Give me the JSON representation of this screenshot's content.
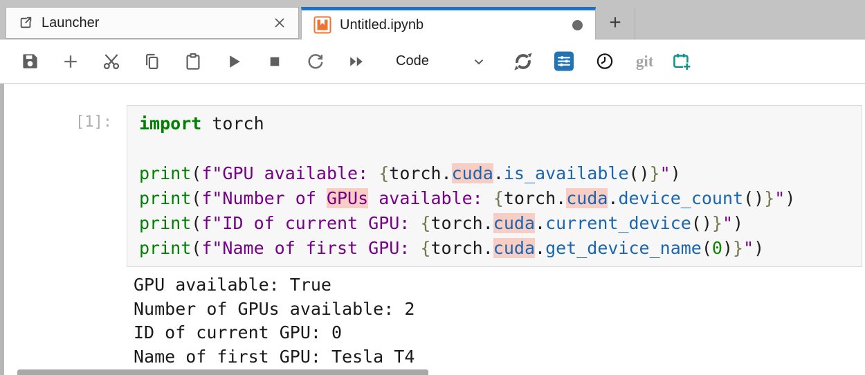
{
  "tab_bar": {
    "tabs": [
      {
        "label": "Launcher",
        "icon": "launcher-icon",
        "active": false,
        "has_close": true
      },
      {
        "label": "Untitled.ipynb",
        "icon": "notebook-icon",
        "active": true,
        "dirty": true
      }
    ],
    "add_tab_label": "+"
  },
  "toolbar": {
    "buttons": [
      "save",
      "insert-cell-below",
      "cut-cells",
      "copy-cells",
      "paste-cells",
      "run-cell",
      "interrupt-kernel",
      "restart-kernel",
      "restart-and-run-all"
    ],
    "cell_type_dropdown": {
      "value": "Code"
    },
    "right_buttons": [
      "kernel-swirl",
      "cell-tools-sliders",
      "history-clock",
      "git",
      "create-scheduled-job"
    ],
    "git_label": "git"
  },
  "cell": {
    "prompt": "[1]:",
    "code_lines": [
      [
        {
          "t": "import",
          "c": "kw"
        },
        {
          "t": " torch",
          "c": "pl"
        }
      ],
      [],
      [
        {
          "t": "print",
          "c": "bi"
        },
        {
          "t": "(",
          "c": "pl"
        },
        {
          "t": "f\"GPU available: ",
          "c": "st"
        },
        {
          "t": "{",
          "c": "br"
        },
        {
          "t": "torch",
          "c": "pl"
        },
        {
          "t": ".",
          "c": "pl"
        },
        {
          "t": "cuda",
          "c": "pr",
          "h": true
        },
        {
          "t": ".",
          "c": "pl"
        },
        {
          "t": "is_available",
          "c": "pr"
        },
        {
          "t": "()",
          "c": "pl"
        },
        {
          "t": "}",
          "c": "br"
        },
        {
          "t": "\"",
          "c": "st"
        },
        {
          "t": ")",
          "c": "pl"
        }
      ],
      [
        {
          "t": "print",
          "c": "bi"
        },
        {
          "t": "(",
          "c": "pl"
        },
        {
          "t": "f\"Number of ",
          "c": "st"
        },
        {
          "t": "GPUs",
          "c": "st",
          "h": true
        },
        {
          "t": " available: ",
          "c": "st"
        },
        {
          "t": "{",
          "c": "br"
        },
        {
          "t": "torch",
          "c": "pl"
        },
        {
          "t": ".",
          "c": "pl"
        },
        {
          "t": "cuda",
          "c": "pr",
          "h": true
        },
        {
          "t": ".",
          "c": "pl"
        },
        {
          "t": "device_count",
          "c": "pr"
        },
        {
          "t": "()",
          "c": "pl"
        },
        {
          "t": "}",
          "c": "br"
        },
        {
          "t": "\"",
          "c": "st"
        },
        {
          "t": ")",
          "c": "pl"
        }
      ],
      [
        {
          "t": "print",
          "c": "bi"
        },
        {
          "t": "(",
          "c": "pl"
        },
        {
          "t": "f\"ID of current GPU: ",
          "c": "st"
        },
        {
          "t": "{",
          "c": "br"
        },
        {
          "t": "torch",
          "c": "pl"
        },
        {
          "t": ".",
          "c": "pl"
        },
        {
          "t": "cuda",
          "c": "pr",
          "h": true
        },
        {
          "t": ".",
          "c": "pl"
        },
        {
          "t": "current_device",
          "c": "pr"
        },
        {
          "t": "()",
          "c": "pl"
        },
        {
          "t": "}",
          "c": "br"
        },
        {
          "t": "\"",
          "c": "st"
        },
        {
          "t": ")",
          "c": "pl"
        }
      ],
      [
        {
          "t": "print",
          "c": "bi"
        },
        {
          "t": "(",
          "c": "pl"
        },
        {
          "t": "f\"Name of first GPU: ",
          "c": "st"
        },
        {
          "t": "{",
          "c": "br"
        },
        {
          "t": "torch",
          "c": "pl"
        },
        {
          "t": ".",
          "c": "pl"
        },
        {
          "t": "cuda",
          "c": "pr",
          "h": true
        },
        {
          "t": ".",
          "c": "pl"
        },
        {
          "t": "get_device_name",
          "c": "pr"
        },
        {
          "t": "(",
          "c": "pl"
        },
        {
          "t": "0",
          "c": "nu"
        },
        {
          "t": ")",
          "c": "pl"
        },
        {
          "t": "}",
          "c": "br"
        },
        {
          "t": "\"",
          "c": "st"
        },
        {
          "t": ")",
          "c": "pl"
        }
      ]
    ],
    "outputs": [
      "GPU available: True",
      "Number of GPUs available: 2",
      "ID of current GPU: 0",
      "Name of first GPU: Tesla T4"
    ]
  },
  "colors": {
    "active_tab_accent": "#1a73c8",
    "notebook_icon_orange": "#ee7531",
    "sliders_button_blue": "#2374b5",
    "scheduler_teal": "#12948b",
    "match_highlight_pink": "#f7cdc4",
    "tabbar_gray": "#c3c3c3"
  }
}
